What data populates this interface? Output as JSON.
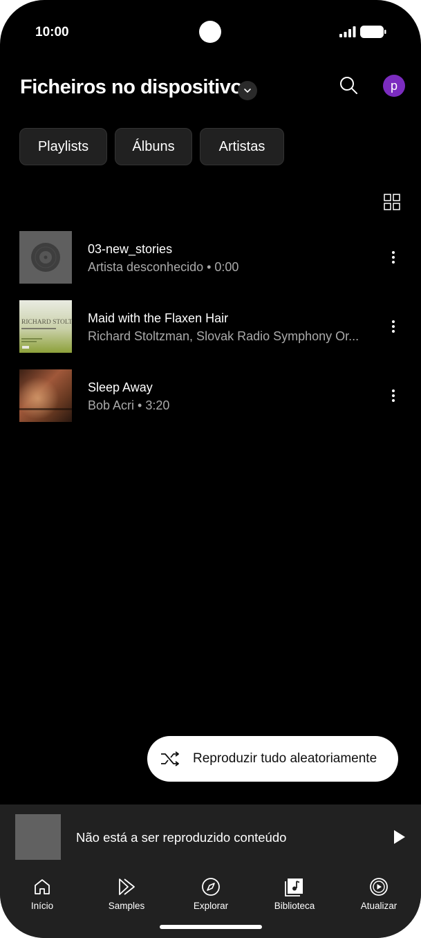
{
  "status_bar": {
    "time": "10:00"
  },
  "header": {
    "title": "Ficheiros no dispositivo",
    "avatar_letter": "p"
  },
  "chips": [
    {
      "label": "Playlists"
    },
    {
      "label": "Álbuns"
    },
    {
      "label": "Artistas"
    }
  ],
  "tracks": [
    {
      "title": "03-new_stories",
      "subtitle": "Artista desconhecido • 0:00",
      "art": "vinyl-placeholder"
    },
    {
      "title": "Maid with the Flaxen Hair",
      "subtitle": "Richard Stoltzman, Slovak Radio Symphony Or...",
      "art": "richard-stoltzman-cover",
      "art_text": "RICHARD STOLTZMAN"
    },
    {
      "title": "Sleep Away",
      "subtitle": "Bob Acri • 3:20",
      "art": "piano-cover"
    }
  ],
  "shuffle": {
    "label": "Reproduzir tudo aleatoriamente"
  },
  "mini_player": {
    "text": "Não está a ser reproduzido conteúdo"
  },
  "nav": [
    {
      "label": "Início",
      "icon": "home-icon"
    },
    {
      "label": "Samples",
      "icon": "samples-icon"
    },
    {
      "label": "Explorar",
      "icon": "compass-icon"
    },
    {
      "label": "Biblioteca",
      "icon": "library-icon"
    },
    {
      "label": "Atualizar",
      "icon": "upgrade-icon"
    }
  ],
  "colors": {
    "background": "#000000",
    "surface": "#212121",
    "avatar": "#7b2cbf",
    "secondary_text": "#aaaaaa"
  }
}
